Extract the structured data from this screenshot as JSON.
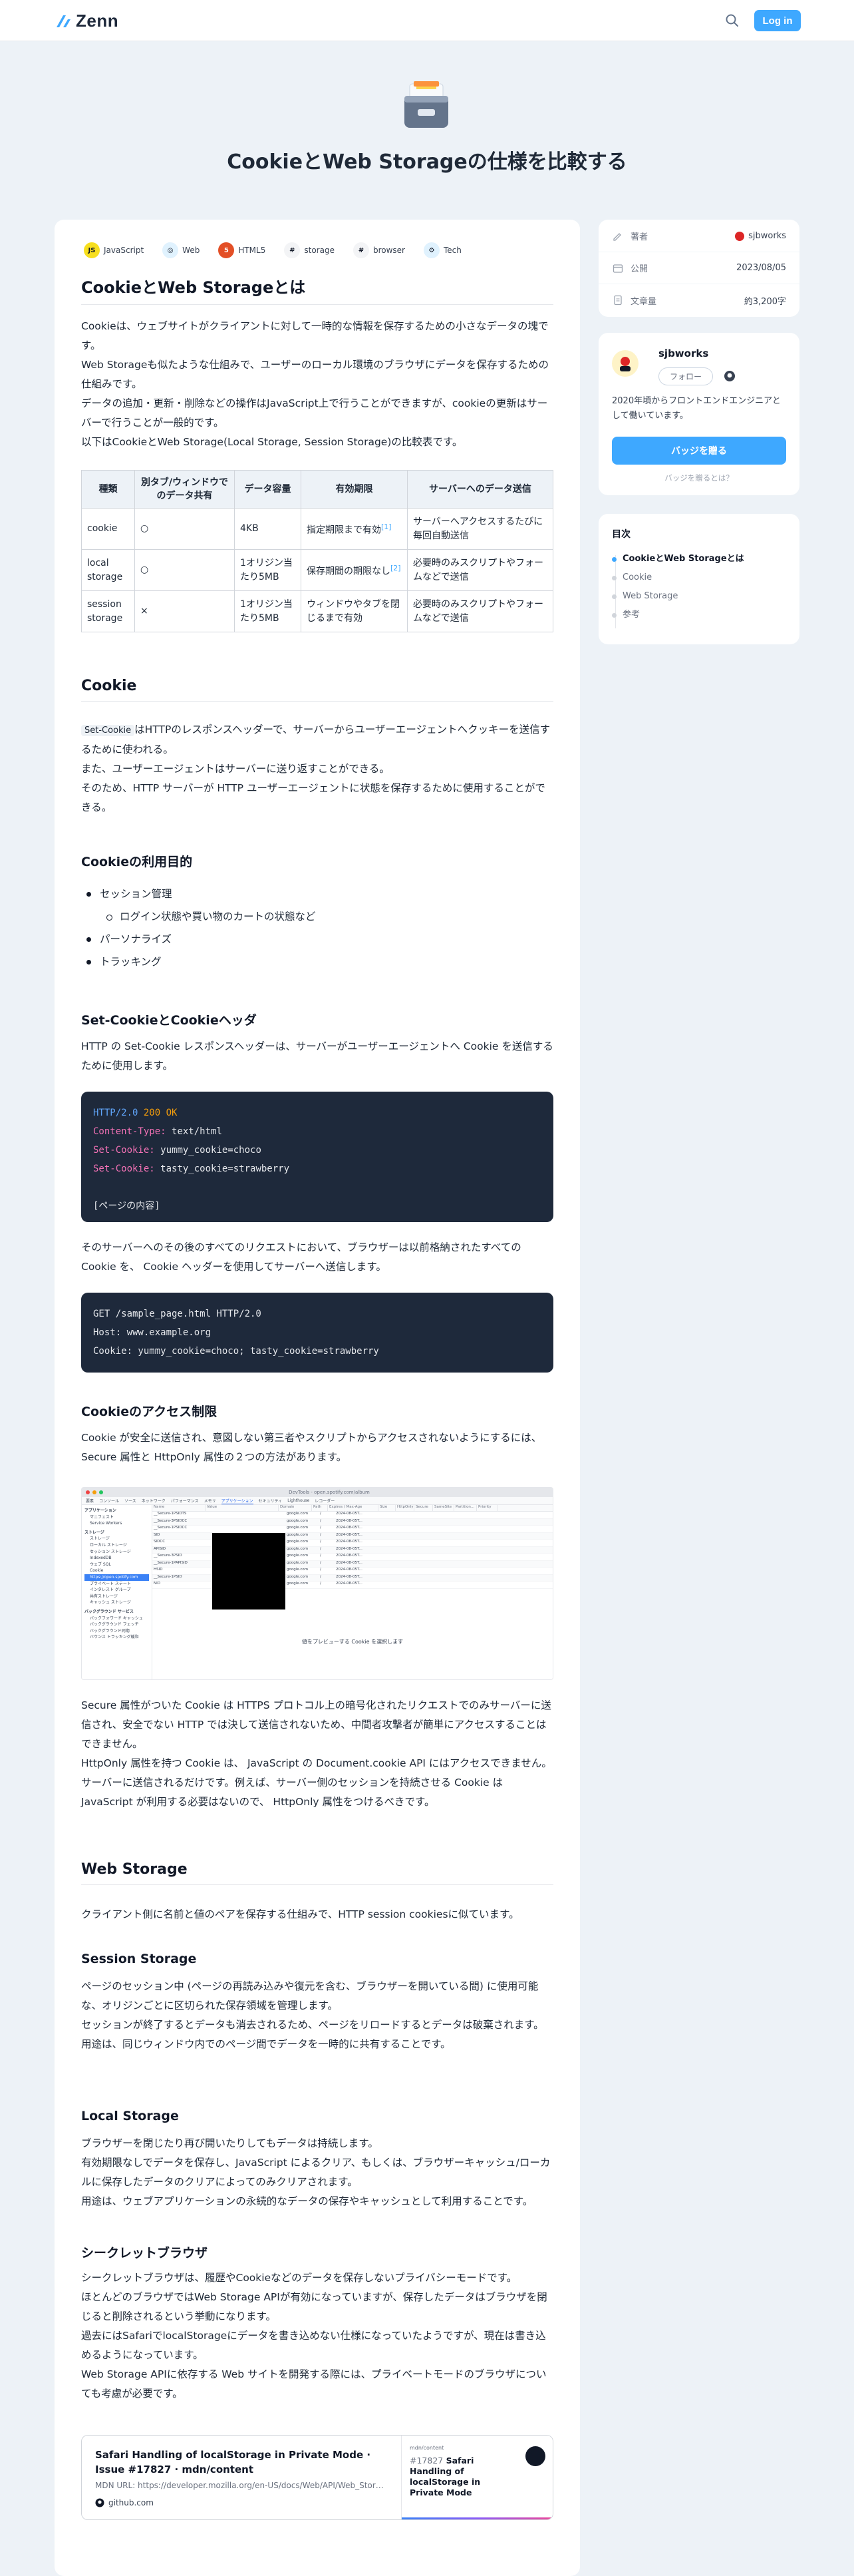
{
  "header": {
    "logo_text": "Zenn",
    "login_label": "Log in"
  },
  "hero": {
    "emoji_name": "card-file-box-icon",
    "title": "CookieとWeb Storageの仕様を比較する"
  },
  "tags": [
    {
      "label": "JavaScript",
      "icon": "js-icon",
      "bg": "#f7df1e",
      "glyph": "JS"
    },
    {
      "label": "Web",
      "icon": "web-icon",
      "bg": "#e0f2fe",
      "glyph": "◎"
    },
    {
      "label": "HTML5",
      "icon": "html5-icon",
      "bg": "#e34f26",
      "glyph": "5"
    },
    {
      "label": "storage",
      "icon": "storage-icon",
      "bg": "#f3f4f6",
      "glyph": "#"
    },
    {
      "label": "browser",
      "icon": "browser-icon",
      "bg": "#f3f4f6",
      "glyph": "#"
    },
    {
      "label": "Tech",
      "icon": "tech-icon",
      "bg": "#e0f2fe",
      "glyph": "⚙"
    }
  ],
  "article": {
    "h1": "CookieとWeb Storageとは",
    "intro": [
      "Cookieは、ウェブサイトがクライアントに対して一時的な情報を保存するための小さなデータの塊です。",
      "Web Storageも似たような仕組みで、ユーザーのローカル環境のブラウザにデータを保存するための仕組みです。",
      "データの追加・更新・削除などの操作はJavaScript上で行うことができますが、cookieの更新はサーバーで行うことが一般的です。",
      "以下はCookieとWeb Storage(Local Storage, Session Storage)の比較表です。"
    ],
    "table": {
      "headers": [
        "種類",
        "別タブ/ウィンドウでのデータ共有",
        "データ容量",
        "有効期限",
        "サーバーへのデータ送信"
      ],
      "rows": [
        [
          "cookie",
          "○",
          "4KB",
          "指定期限まで有効",
          "サーバーへアクセスするたびに毎回自動送信"
        ],
        [
          "local storage",
          "○",
          "1オリジン当たり5MB",
          "保存期間の期限なし",
          "必要時のみスクリプトやフォームなどで送信"
        ],
        [
          "session storage",
          "×",
          "1オリジン当たり5MB",
          "ウィンドウやタブを閉じるまで有効",
          "必要時のみスクリプトやフォームなどで送信"
        ]
      ],
      "footnotes": [
        "[1]",
        "[2]"
      ]
    },
    "cookie_h2": "Cookie",
    "cookie_code_inline": "Set-Cookie",
    "cookie_p": [
      "はHTTPのレスポンスヘッダーで、サーバーからユーザーエージェントへクッキーを送信するために使われる。",
      "また、ユーザーエージェントはサーバーに送り返すことができる。",
      "そのため、HTTP サーバーが HTTP ユーザーエージェントに状態を保存するために使用することができる。"
    ],
    "purpose_h3": "Cookieの利用目的",
    "purpose_list": [
      "セッション管理",
      "ログイン状態や買い物のカートの状態など",
      "パーソナライズ",
      "トラッキング"
    ],
    "setcookie_h3": "Set-CookieとCookieヘッダ",
    "setcookie_p": "HTTP の Set-Cookie レスポンスヘッダーは、サーバーがユーザーエージェントへ Cookie を送信するために使用します。",
    "code1": {
      "http": "HTTP/2.0",
      "status_num": "200",
      "status_text": "OK",
      "l2k": "Content-Type:",
      "l2v": "text/html",
      "l3k": "Set-Cookie:",
      "l3v": "yummy_cookie=choco",
      "l4k": "Set-Cookie:",
      "l4v": "tasty_cookie=strawberry",
      "body": "[ページの内容]"
    },
    "after_code1": "そのサーバーへのその後のすべてのリクエストにおいて、ブラウザーは以前格納されたすべての Cookie を、 Cookie ヘッダーを使用してサーバーへ送信します。",
    "code2": [
      "GET /sample_page.html HTTP/2.0",
      "Host: www.example.org",
      "Cookie: yummy_cookie=choco; tasty_cookie=strawberry"
    ],
    "access_h3": "Cookieのアクセス制限",
    "access_p": "Cookie が安全に送信され、意図しない第三者やスクリプトからアクセスされないようにするには、 Secure 属性と HttpOnly 属性の２つの方法があります。",
    "screenshot": {
      "window_title": "DevTools - open.spotify.com/album",
      "tabs": [
        "要素",
        "コンソール",
        "ソース",
        "ネットワーク",
        "パフォーマンス",
        "メモリ",
        "アプリケーション",
        "セキュリティ",
        "Lighthouse",
        "レコーダー"
      ],
      "sidebar": [
        "アプリケーション",
        "マニフェスト",
        "Service Workers",
        "ストレージ",
        "ストレージ",
        "ローカル ストレージ",
        "セッション ストレージ",
        "IndexedDB",
        "ウェブ SQL",
        "Cookie",
        "https://open.spotify.com",
        "プライベート ステート",
        "インタレスト グループ",
        "共有ストレージ",
        "キャッシュ ストレージ",
        "バックグラウンド サービス",
        "バックフォワード キャッシュ",
        "バックグラウンド フェッチ",
        "バックグラウンド同期",
        "バウンス トラッキング緩和"
      ],
      "columns": [
        "Name",
        "Value",
        "Domain",
        "Path",
        "Expires / Max-Age",
        "Size",
        "HttpOnly",
        "Secure",
        "SameSite",
        "Partition...",
        "Priority"
      ],
      "rows": [
        [
          "__Secure-1PSIDTS",
          "google.com",
          "/",
          "2024-08-05T..."
        ],
        [
          "__Secure-3PSIDCC",
          "google.com",
          "/",
          "2024-08-05T..."
        ],
        [
          "__Secure-1PSIDCC",
          "google.com",
          "/",
          "2024-08-05T..."
        ],
        [
          "SID",
          "google.com",
          "/",
          "2024-08-05T..."
        ],
        [
          "SIDCC",
          "google.com",
          "/",
          "2024-08-05T..."
        ],
        [
          "APISID",
          "google.com",
          "/",
          "2024-08-05T..."
        ],
        [
          "__Secure-3PSID",
          "google.com",
          "/",
          "2024-08-05T..."
        ],
        [
          "__Secure-1PAPISID",
          "google.com",
          "/",
          "2024-08-05T..."
        ],
        [
          "HSID",
          "google.com",
          "/",
          "2024-08-05T..."
        ],
        [
          "__Secure-1PSID",
          "google.com",
          "/",
          "2024-08-05T..."
        ],
        [
          "NID",
          "google.com",
          "/",
          "2024-08-05T..."
        ]
      ],
      "preview_caption": "値をプレビューする Cookie を選択します"
    },
    "secure_p": [
      "Secure 属性がついた Cookie は HTTPS プロトコル上の暗号化されたリクエストでのみサーバーに送信され、安全でない HTTP では決して送信されないため、中間者攻撃者が簡単にアクセスすることはできません。",
      "HttpOnly 属性を持つ Cookie は、 JavaScript の Document.cookie API にはアクセスできません。サーバーに送信されるだけです。例えば、サーバー側のセッションを持続させる Cookie は JavaScript が利用する必要はないので、 HttpOnly 属性をつけるべきです。"
    ],
    "webstorage_h2": "Web Storage",
    "webstorage_p": "クライアント側に名前と値のペアを保存する仕組みで、HTTP session cookiesに似ています。",
    "session_h3": "Session Storage",
    "session_p": [
      "ページのセッション中 (ページの再読み込みや復元を含む、ブラウザーを開いている間) に使用可能な、オリジンごとに区切られた保存領域を管理します。",
      "セッションが終了するとデータも消去されるため、ページをリロードするとデータは破棄されます。",
      "用途は、同じウィンドウ内でのページ間でデータを一時的に共有することです。"
    ],
    "local_h3": "Local Storage",
    "local_p": [
      "ブラウザーを閉じたり再び開いたりしてもデータは持続します。",
      "有効期限なしでデータを保存し、JavaScript によるクリア、もしくは、ブラウザーキャッシュ/ローカルに保存したデータのクリアによってのみクリアされます。",
      "用途は、ウェブアプリケーションの永続的なデータの保存やキャッシュとして利用することです。"
    ],
    "secret_h3": "シークレットブラウザ",
    "secret_p": [
      "シークレットブラウザは、履歴やCookieなどのデータを保存しないプライバシーモードです。",
      "ほとんどのブラウザではWeb Storage APIが有効になっていますが、保存したデータはブラウザを閉じると削除されるという挙動になります。",
      "過去にはSafariでlocalStorageにデータを書き込めない仕様になっていたようですが、現在は書き込めるようになっています。",
      "Web Storage APIに依存する Web サイトを開発する際には、プライベートモードのブラウザについても考慮が必要です。"
    ],
    "linkcard": {
      "title": "Safari Handling of localStorage in Private Mode · Issue #17827 · mdn/content",
      "desc": "MDN URL: https://developer.mozilla.org/en-US/docs/Web/API/Web_Stora...",
      "domain": "github.com",
      "thumb_repo": "mdn/content",
      "thumb_issue": "#17827",
      "thumb_title": "Safari Handling of localStorage in Private Mode"
    }
  },
  "sidebar": {
    "meta": [
      {
        "label": "著者",
        "value": "sjbworks",
        "icon": "pencil-icon"
      },
      {
        "label": "公開",
        "value": "2023/08/05",
        "icon": "calendar-icon"
      },
      {
        "label": "文章量",
        "value": "約3,200字",
        "icon": "document-icon"
      }
    ],
    "author": {
      "name": "sjbworks",
      "follow": "フォロー",
      "bio": "2020年頃からフロントエンドエンジニアとして働いています。",
      "badge_button": "バッジを贈る",
      "badge_link": "バッジを贈るとは？"
    },
    "toc": {
      "title": "目次",
      "items": [
        "CookieとWeb Storageとは",
        "Cookie",
        "Web Storage",
        "参考"
      ]
    }
  }
}
